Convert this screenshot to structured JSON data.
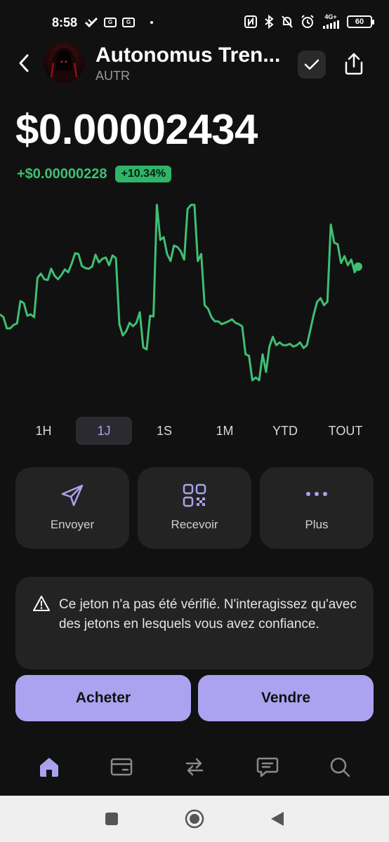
{
  "status_bar": {
    "time": "8:58",
    "badge_1": "G",
    "badge_2": "G",
    "network": "4G+",
    "battery": "60"
  },
  "header": {
    "token_name": "Autonomus Tren...",
    "token_symbol": "AUTR",
    "icons": [
      "back-chevron",
      "avatar",
      "check",
      "share"
    ]
  },
  "price": {
    "value": "$0.00002434",
    "change_abs": "+$0.00000228",
    "change_pct": "+10.34%"
  },
  "chart_data": {
    "type": "line",
    "title": "",
    "xlabel": "",
    "ylabel": "",
    "grid": false,
    "color": "#3fbf73",
    "y": [
      168,
      172,
      188,
      188,
      183,
      181,
      149,
      152,
      170,
      168,
      172,
      116,
      110,
      118,
      119,
      103,
      113,
      118,
      112,
      104,
      108,
      96,
      81,
      82,
      99,
      102,
      103,
      100,
      83,
      94,
      89,
      87,
      98,
      84,
      88,
      182,
      198,
      192,
      180,
      185,
      180,
      165,
      215,
      218,
      170,
      171,
      12,
      62,
      58,
      82,
      92,
      70,
      72,
      78,
      90,
      18,
      12,
      12,
      92,
      82,
      155,
      160,
      172,
      178,
      178,
      182,
      180,
      178,
      175,
      180,
      182,
      185,
      225,
      227,
      262,
      258,
      262,
      225,
      250,
      214,
      200,
      212,
      208,
      212,
      212,
      210,
      214,
      212,
      208,
      216,
      212,
      190,
      168,
      150,
      145,
      155,
      150,
      40,
      66,
      68,
      95,
      85,
      98,
      90,
      108,
      100
    ]
  },
  "ranges": {
    "items": [
      "1H",
      "1J",
      "1S",
      "1M",
      "YTD",
      "TOUT"
    ],
    "active": "1J"
  },
  "actions": {
    "send": "Envoyer",
    "receive": "Recevoir",
    "more": "Plus"
  },
  "warning": {
    "text": "Ce jeton n'a pas été vérifié. N'interagissez qu'avec des jetons en lesquels vous avez confiance."
  },
  "trade": {
    "buy": "Acheter",
    "sell": "Vendre"
  },
  "bottom_nav": {
    "icons": [
      "home",
      "wallet",
      "swap",
      "chat",
      "search"
    ],
    "active": "home"
  },
  "colors": {
    "background": "#111111",
    "accent": "#aba3f0",
    "positive": "#3fbf73",
    "card": "#232323"
  }
}
